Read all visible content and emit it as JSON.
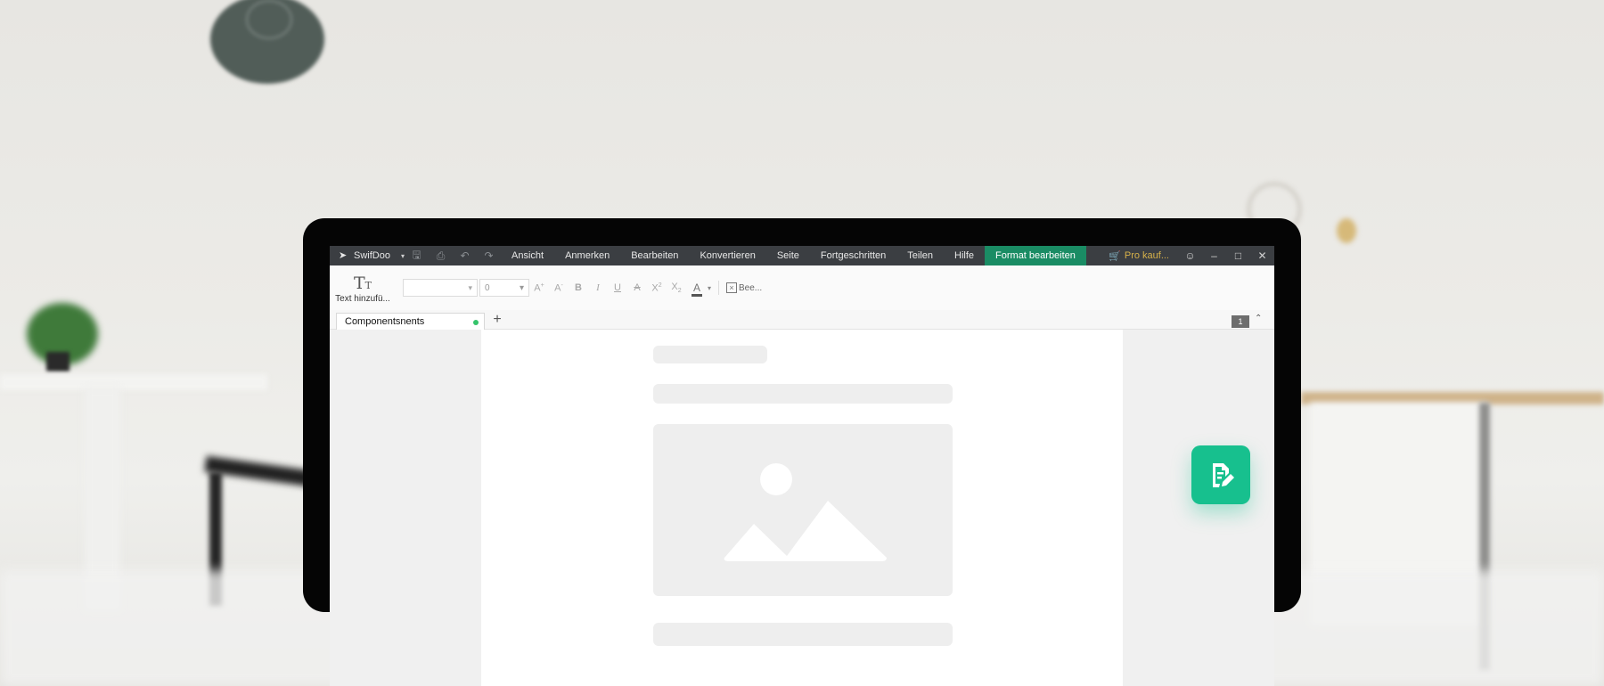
{
  "app": {
    "brand": "SwifDoo",
    "menu": [
      "Ansicht",
      "Anmerken",
      "Bearbeiten",
      "Konvertieren",
      "Seite",
      "Fortgeschritten",
      "Teilen",
      "Hilfe",
      "Format bearbeiten"
    ],
    "active_menu": "Format bearbeiten",
    "pro_label": "Pro kauf..."
  },
  "ribbon": {
    "add_text_label": "Text hinzufü...",
    "font_name": "",
    "font_size": "0",
    "edit_label": "Bee..."
  },
  "tabs": {
    "document_tab": "Componentsnents",
    "page_indicator": "1"
  },
  "colors": {
    "accent": "#1a8c64",
    "fab": "#17c08e",
    "title_bar": "#3b3e42"
  }
}
